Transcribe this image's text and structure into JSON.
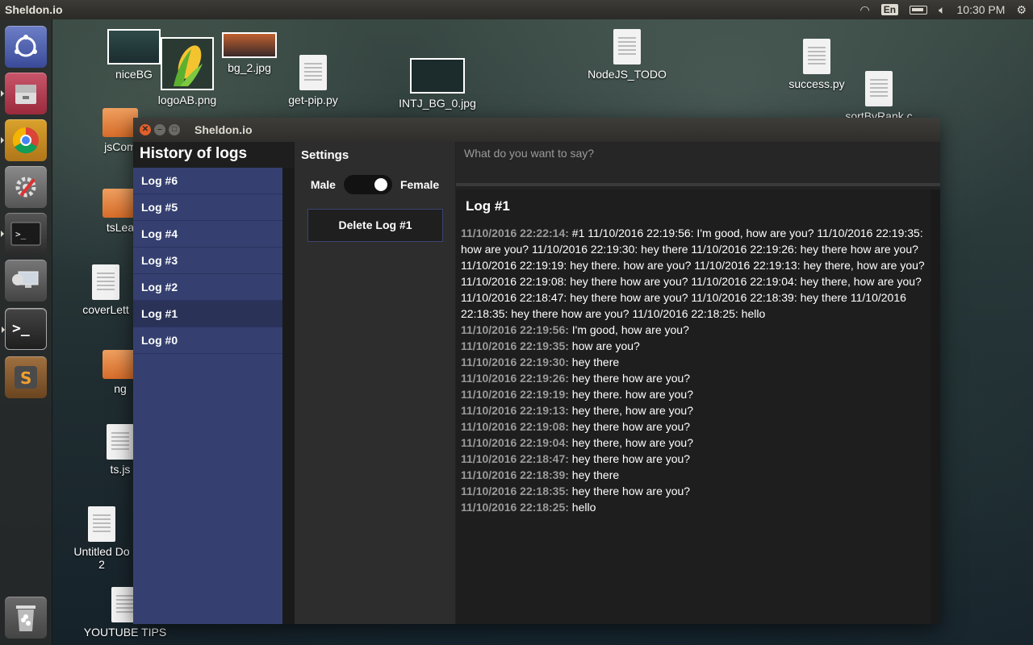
{
  "top_panel": {
    "app_name": "Sheldon.io",
    "keyboard": "En",
    "time": "10:30 PM"
  },
  "desktop_icons": [
    {
      "label": "niceBG"
    },
    {
      "label": "logoAB.png"
    },
    {
      "label": "bg_2.jpg"
    },
    {
      "label": "get-pip.py"
    },
    {
      "label": "INTJ_BG_0.jpg"
    },
    {
      "label": "NodeJS_TODO"
    },
    {
      "label": "success.py"
    },
    {
      "label": "sortByRank.c"
    },
    {
      "label": "jsCom"
    },
    {
      "label": "tsLea"
    },
    {
      "label": "coverLett"
    },
    {
      "label": "ng"
    },
    {
      "label": "ts.js"
    },
    {
      "label": "Untitled Do"
    },
    {
      "label": "2"
    },
    {
      "label": "YOUTUBE TIPS"
    }
  ],
  "window": {
    "title": "Sheldon.io",
    "history": {
      "heading": "History of logs",
      "items": [
        "Log #6",
        "Log #5",
        "Log #4",
        "Log #3",
        "Log #2",
        "Log #1",
        "Log #0"
      ],
      "active": "Log #1"
    },
    "settings": {
      "heading": "Settings",
      "male_label": "Male",
      "female_label": "Female",
      "toggle_state": "female",
      "delete_label": "Delete Log #1"
    },
    "main": {
      "input_placeholder": "What do you want to say?",
      "log_title": "Log #1",
      "log_lines": [
        {
          "ts": "11/10/2016 22:22:14:",
          "text": " #1 11/10/2016 22:19:56: I'm good, how are you? 11/10/2016 22:19:35: how are you? 11/10/2016 22:19:30: hey there 11/10/2016 22:19:26: hey there how are you? 11/10/2016 22:19:19: hey there. how are you? 11/10/2016 22:19:13: hey there, how are you? 11/10/2016 22:19:08: hey there how are you? 11/10/2016 22:19:04: hey there, how are you? 11/10/2016 22:18:47: hey there how are you? 11/10/2016 22:18:39: hey there 11/10/2016 22:18:35: hey there how are you? 11/10/2016 22:18:25: hello"
        },
        {
          "ts": "11/10/2016 22:19:56:",
          "text": " I'm good, how are you?"
        },
        {
          "ts": "11/10/2016 22:19:35:",
          "text": " how are you?"
        },
        {
          "ts": "11/10/2016 22:19:30:",
          "text": " hey there"
        },
        {
          "ts": "11/10/2016 22:19:26:",
          "text": " hey there how are you?"
        },
        {
          "ts": "11/10/2016 22:19:19:",
          "text": " hey there. how are you?"
        },
        {
          "ts": "11/10/2016 22:19:13:",
          "text": " hey there, how are you?"
        },
        {
          "ts": "11/10/2016 22:19:08:",
          "text": " hey there how are you?"
        },
        {
          "ts": "11/10/2016 22:19:04:",
          "text": " hey there, how are you?"
        },
        {
          "ts": "11/10/2016 22:18:47:",
          "text": " hey there how are you?"
        },
        {
          "ts": "11/10/2016 22:18:39:",
          "text": " hey there"
        },
        {
          "ts": "11/10/2016 22:18:35:",
          "text": " hey there how are you?"
        },
        {
          "ts": "11/10/2016 22:18:25:",
          "text": " hello"
        }
      ]
    }
  },
  "launcher": [
    {
      "icon": "ubuntu-icon"
    },
    {
      "icon": "files-icon"
    },
    {
      "icon": "chrome-icon"
    },
    {
      "icon": "settings-icon"
    },
    {
      "icon": "terminal-icon"
    },
    {
      "icon": "remote-desktop-icon"
    },
    {
      "icon": "terminal-icon"
    },
    {
      "icon": "sublime-text-icon"
    },
    {
      "icon": "trash-icon"
    }
  ],
  "colors": {
    "log_list_bg": "#354070",
    "log_active_bg": "#2a3258",
    "close_button": "#e05e2b"
  }
}
